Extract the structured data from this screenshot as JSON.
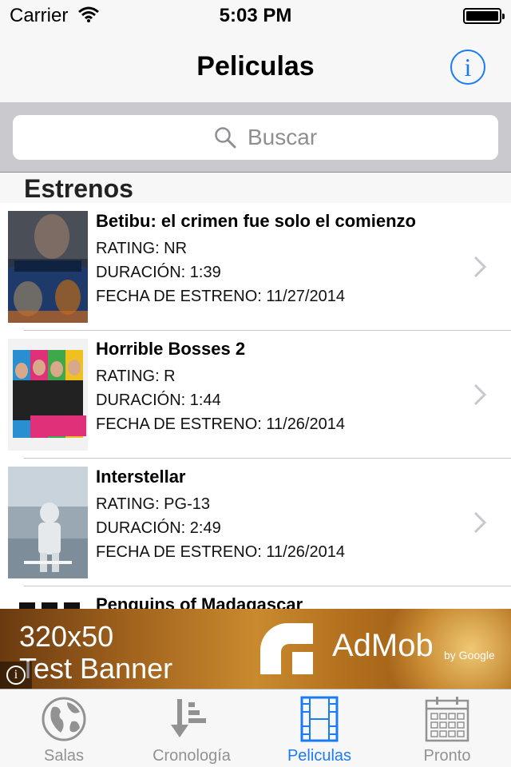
{
  "status_bar": {
    "carrier": "Carrier",
    "time": "5:03 PM"
  },
  "nav": {
    "title": "Peliculas",
    "info_icon": "info-icon",
    "info_glyph": "i"
  },
  "search": {
    "placeholder": "Buscar"
  },
  "section": {
    "title": "Estrenos"
  },
  "movies": [
    {
      "title": "Betibu: el crimen fue solo el comienzo",
      "rating": "RATING: NR",
      "duration": "DURACIÓN: 1:39",
      "release": "FECHA DE ESTRENO: 11/27/2014"
    },
    {
      "title": "Horrible Bosses 2",
      "rating": "RATING: R",
      "duration": "DURACIÓN: 1:44",
      "release": "FECHA DE ESTRENO: 11/26/2014"
    },
    {
      "title": "Interstellar",
      "rating": "RATING: PG-13",
      "duration": "DURACIÓN: 2:49",
      "release": "FECHA DE ESTRENO: 11/26/2014"
    },
    {
      "title": "Penguins of Madagascar"
    }
  ],
  "ad": {
    "line1": "320x50",
    "line2": "Test Banner",
    "brand": "AdMob",
    "by": "by Google"
  },
  "tabs": [
    {
      "label": "Salas",
      "icon": "globe-icon",
      "active": false
    },
    {
      "label": "Cronología",
      "icon": "sort-timeline-icon",
      "active": false
    },
    {
      "label": "Peliculas",
      "icon": "film-icon",
      "active": true
    },
    {
      "label": "Pronto",
      "icon": "calendar-icon",
      "active": false
    }
  ],
  "colors": {
    "accent": "#1a7cf5",
    "inactive": "#929292",
    "search_bg": "#c9c9ce"
  }
}
